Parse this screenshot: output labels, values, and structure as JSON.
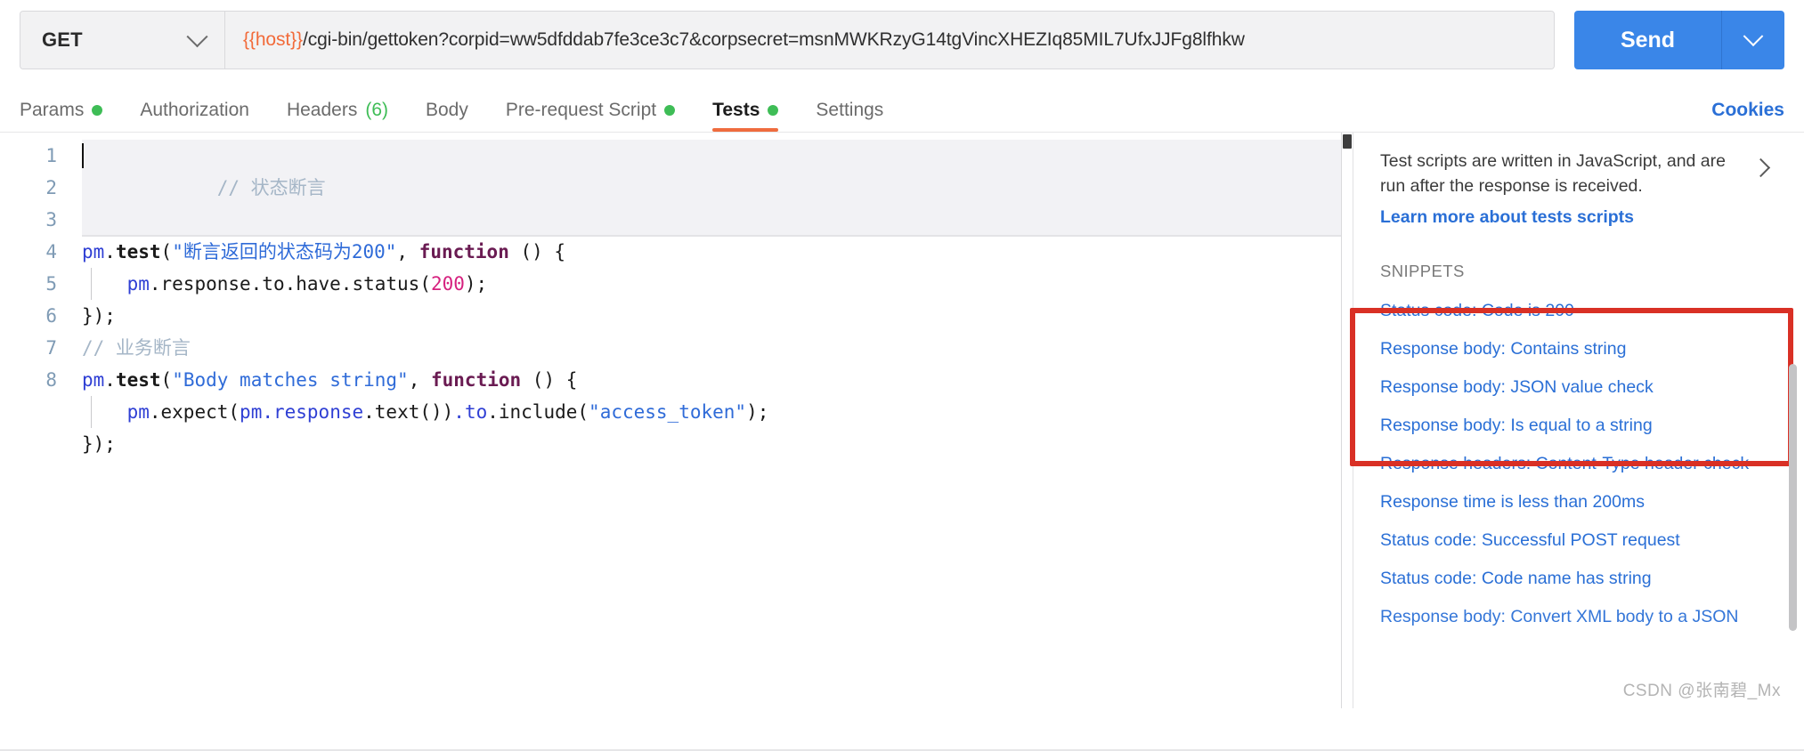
{
  "request_bar": {
    "method": "GET",
    "method_chevron_icon": "chevron-down-icon",
    "url": "{{host}}/cgi-bin/gettoken?corpid=ww5dfddab7fe3ce3c7&corpsecret=msnMWKRzyG14tgVincXHEZIq85MIL7UfxJJFg8lfhkw",
    "url_variable": "{{host}}",
    "url_rest": "/cgi-bin/gettoken?corpid=ww5dfddab7fe3ce3c7&corpsecret=msnMWKRzyG14tgVincXHEZIq85MIL7UfxJJFg8lfhkw",
    "send_label": "Send",
    "send_caret_icon": "chevron-down-icon",
    "accent_color": "#3a86e8",
    "variable_color": "#f26b3a"
  },
  "tabs": [
    {
      "label": "Params",
      "has_dot": true,
      "count": "",
      "active": false
    },
    {
      "label": "Authorization",
      "has_dot": false,
      "count": "",
      "active": false
    },
    {
      "label": "Headers",
      "has_dot": false,
      "count": "(6)",
      "active": false
    },
    {
      "label": "Body",
      "has_dot": false,
      "count": "",
      "active": false
    },
    {
      "label": "Pre-request Script",
      "has_dot": true,
      "count": "",
      "active": false
    },
    {
      "label": "Tests",
      "has_dot": true,
      "count": "",
      "active": true
    },
    {
      "label": "Settings",
      "has_dot": false,
      "count": "",
      "active": false
    }
  ],
  "cookies_label": "Cookies",
  "tab_indicator_color": "#ef6c3e",
  "dot_color": "#3ebd56",
  "editor": {
    "line_numbers": [
      "1",
      "2",
      "3",
      "4",
      "5",
      "6",
      "7",
      "8"
    ],
    "lines": [
      {
        "n": 1,
        "text": "// 状态断言"
      },
      {
        "n": 2,
        "text": "pm.test(\"断言返回的状态码为200\", function () {"
      },
      {
        "n": 3,
        "text": "    pm.response.to.have.status(200);"
      },
      {
        "n": 4,
        "text": "});"
      },
      {
        "n": 5,
        "text": "// 业务断言"
      },
      {
        "n": 6,
        "text": "pm.test(\"Body matches string\", function () {"
      },
      {
        "n": 7,
        "text": "    pm.expect(pm.response.text()).to.include(\"access_token\");"
      },
      {
        "n": 8,
        "text": "});"
      }
    ],
    "tokens": {
      "l1_comment": "// 状态断言",
      "l2_pm": "pm",
      "l2_dot": ".",
      "l2_test": "test",
      "l2_open": "(",
      "l2_str": "\"断言返回的状态码为200\"",
      "l2_comma": ", ",
      "l2_function": "function",
      "l2_tail": " () {",
      "l3_pm": "pm",
      "l3_chain": ".response.to.have.status",
      "l3_open": "(",
      "l3_num": "200",
      "l3_close": ");",
      "l4": "});",
      "l5_comment": "// 业务断言",
      "l6_pm": "pm",
      "l6_dot": ".",
      "l6_test": "test",
      "l6_open": "(",
      "l6_str": "\"Body matches string\"",
      "l6_comma": ", ",
      "l6_function": "function",
      "l6_tail": " () {",
      "l7_pm1": "pm",
      "l7_expect": ".expect",
      "l7_open": "(",
      "l7_pm2": "pm",
      "l7_resp": ".response",
      "l7_text": ".text",
      "l7_parens": "())",
      "l7_to": ".to",
      "l7_include": ".include",
      "l7_open2": "(",
      "l7_str": "\"access_token\"",
      "l7_close": ");",
      "l8": "});"
    }
  },
  "side_panel": {
    "intro_text": "Test scripts are written in JavaScript, and are run after the response is received.",
    "expand_icon": "chevron-right-icon",
    "learn_more_label": "Learn more about tests scripts",
    "snippets_heading": "SNIPPETS",
    "snippets": [
      "Status code: Code is 200",
      "Response body: Contains string",
      "Response body: JSON value check",
      "Response body: Is equal to a string",
      "Response headers: Content-Type header check",
      "Response time is less than 200ms",
      "Status code: Successful POST request",
      "Status code: Code name has string",
      "Response body: Convert XML body to a JSON"
    ],
    "highlight_box_color": "#d93025",
    "link_color": "#2a6fd6"
  },
  "watermark": "CSDN @张南碧_Mx"
}
